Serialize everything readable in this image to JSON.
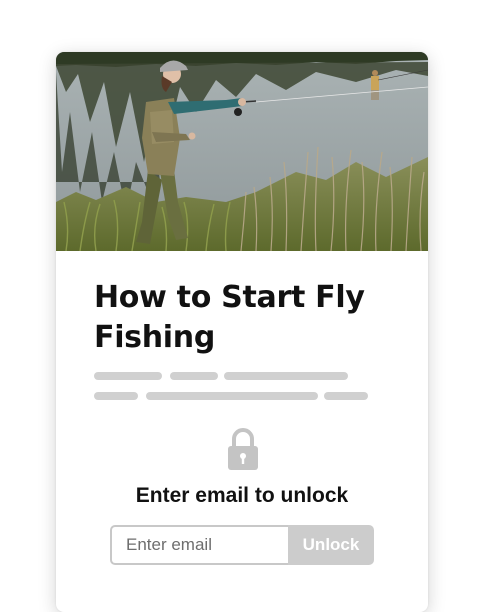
{
  "article": {
    "title": "How to Start Fly Fishing"
  },
  "hero": {
    "image_icon": "fly-fishing-photo",
    "colors": {
      "water": "#9aa3a5",
      "trees": "#2f3a22",
      "grass": "#6f7f3a"
    }
  },
  "gate": {
    "lock_icon": "lock-icon",
    "heading": "Enter email to unlock",
    "email_placeholder": "Enter email",
    "button_label": "Unlock",
    "colors": {
      "button_bg": "#cccccc",
      "lock": "#c4c4c4",
      "skeleton": "#d0d0d0"
    }
  }
}
